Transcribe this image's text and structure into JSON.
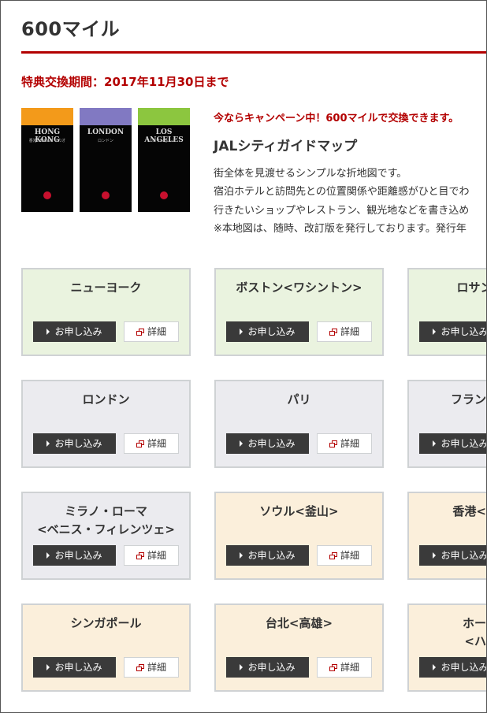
{
  "page": {
    "title": "600マイル",
    "period": "特典交換期間：2017年11月30日まで"
  },
  "books": [
    {
      "city": "HONG KONG",
      "sub": "香港 MACAU マカオ",
      "band": "#f39a1a"
    },
    {
      "city": "LONDON",
      "sub": "ロンドン",
      "band": "#8179c2"
    },
    {
      "city": "LOS ANGELES",
      "sub": "ロサンゼルス",
      "band": "#8cc63f"
    }
  ],
  "product": {
    "campaign": "今ならキャンペーン中！600マイルで交換できます。",
    "name": "JALシティガイドマップ",
    "desc": [
      "街全体を見渡せるシンプルな折地図です。",
      "宿泊ホテルと訪問先との位置関係や距離感がひと目でわ",
      "行きたいショップやレストラン、観光地などを書き込め",
      "※本地図は、随時、改訂版を発行しております。発行年"
    ]
  },
  "buttons": {
    "apply": "お申し込み",
    "detail": "詳細"
  },
  "cities": [
    {
      "name": "ニューヨーク",
      "name2": ""
    },
    {
      "name": "ボストン<ワシントン>",
      "name2": ""
    },
    {
      "name": "ロサンゼルス",
      "name2": ""
    },
    {
      "name": "ロンドン",
      "name2": ""
    },
    {
      "name": "パリ",
      "name2": ""
    },
    {
      "name": "フランクフルト",
      "name2": ""
    },
    {
      "name": "ミラノ・ローマ",
      "name2": "<ベニス・フィレンツェ>"
    },
    {
      "name": "ソウル<釜山>",
      "name2": ""
    },
    {
      "name": "香港<マカオ>",
      "name2": ""
    },
    {
      "name": "シンガポール",
      "name2": ""
    },
    {
      "name": "台北<高雄>",
      "name2": ""
    },
    {
      "name": "ホーチミン",
      "name2": "<ハノイ>"
    }
  ]
}
